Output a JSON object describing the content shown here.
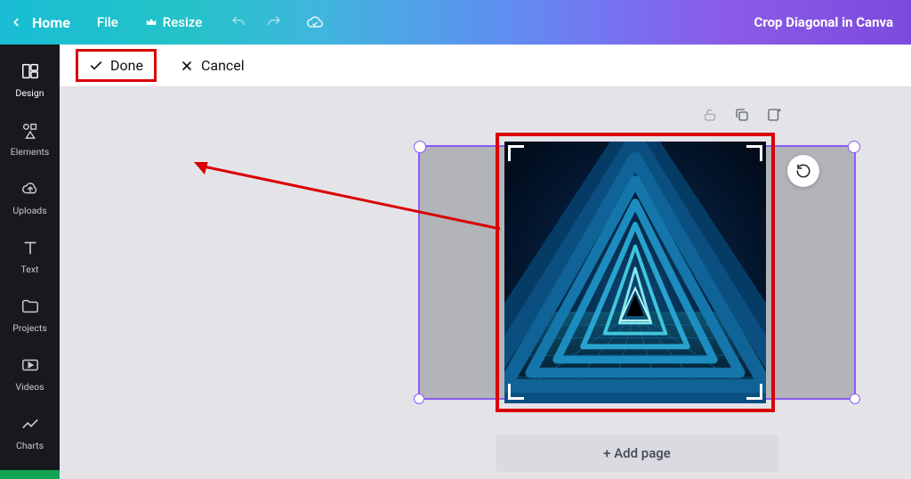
{
  "topbar": {
    "home": "Home",
    "file": "File",
    "resize": "Resize",
    "title": "Crop Diagonal in Canva"
  },
  "secondbar": {
    "done": "Done",
    "cancel": "Cancel"
  },
  "sidebar": {
    "items": [
      {
        "label": "Design"
      },
      {
        "label": "Elements"
      },
      {
        "label": "Uploads"
      },
      {
        "label": "Text"
      },
      {
        "label": "Projects"
      },
      {
        "label": "Videos"
      },
      {
        "label": "Charts"
      }
    ]
  },
  "canvas": {
    "add_page": "+ Add page"
  }
}
